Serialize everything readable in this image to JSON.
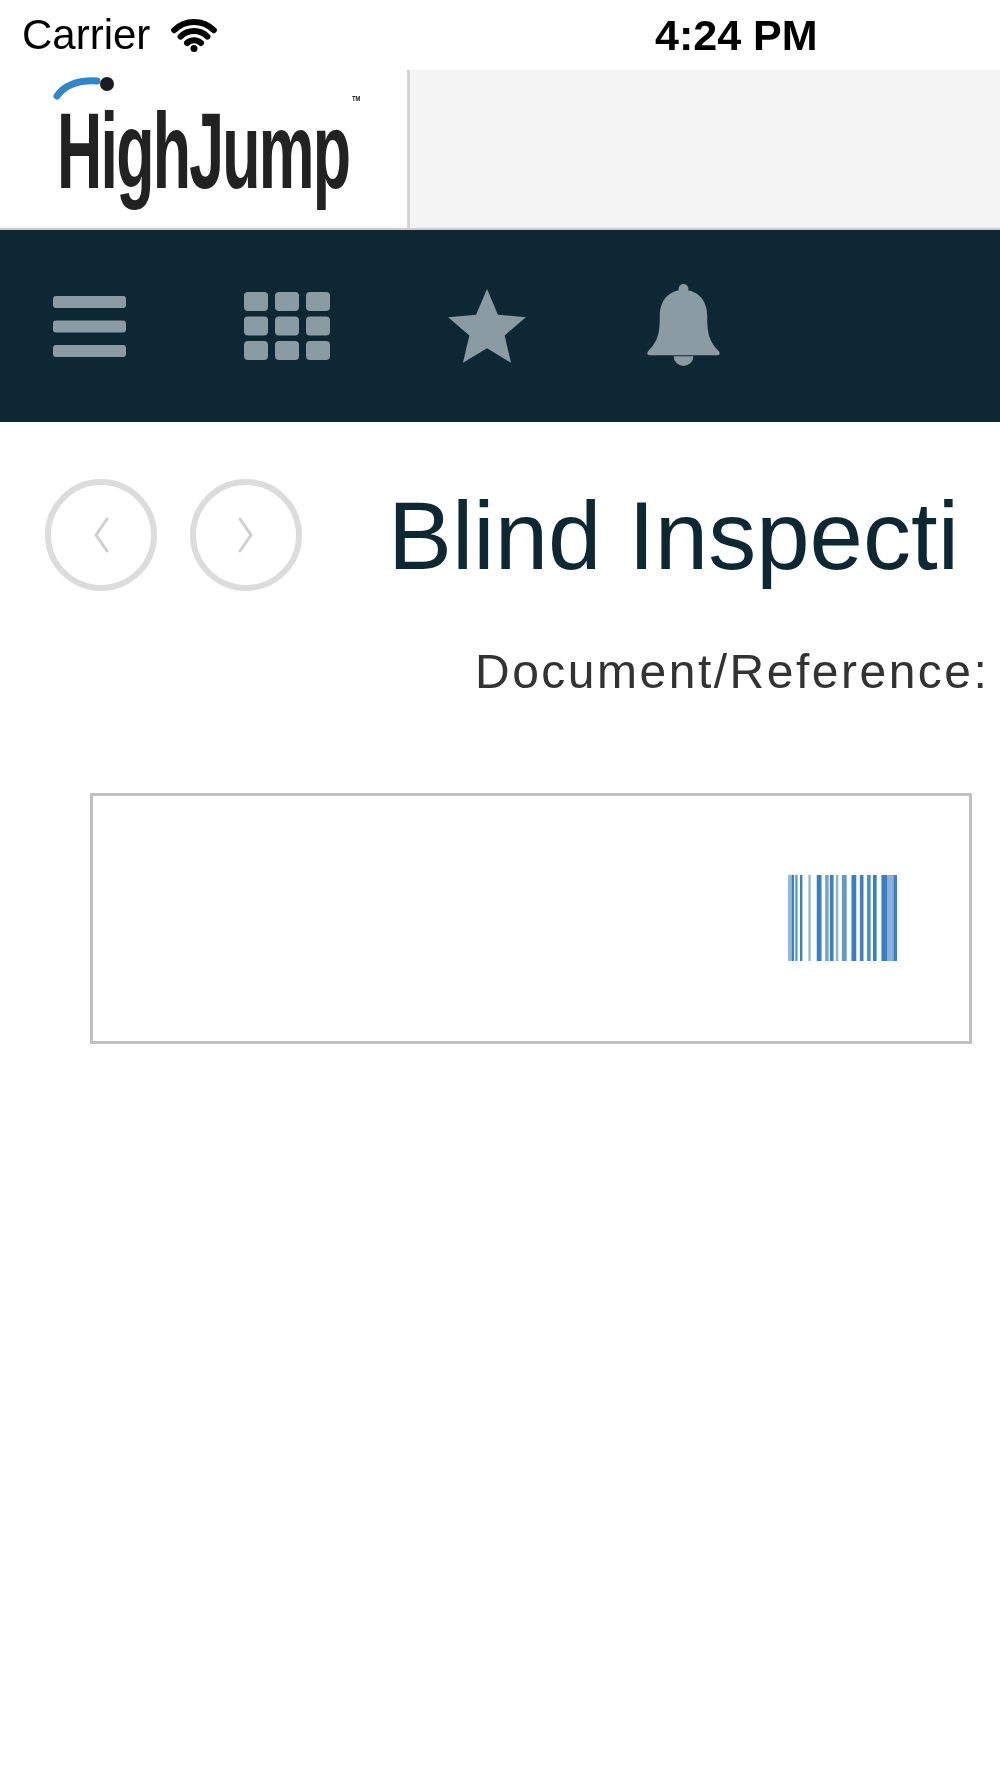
{
  "status_bar": {
    "carrier": "Carrier",
    "time": "4:24 PM"
  },
  "header": {
    "logo": "HighJump$^{™}$"
  },
  "page": {
    "title": "Blind Inspecti",
    "field_label": "Document/Reference:"
  }
}
